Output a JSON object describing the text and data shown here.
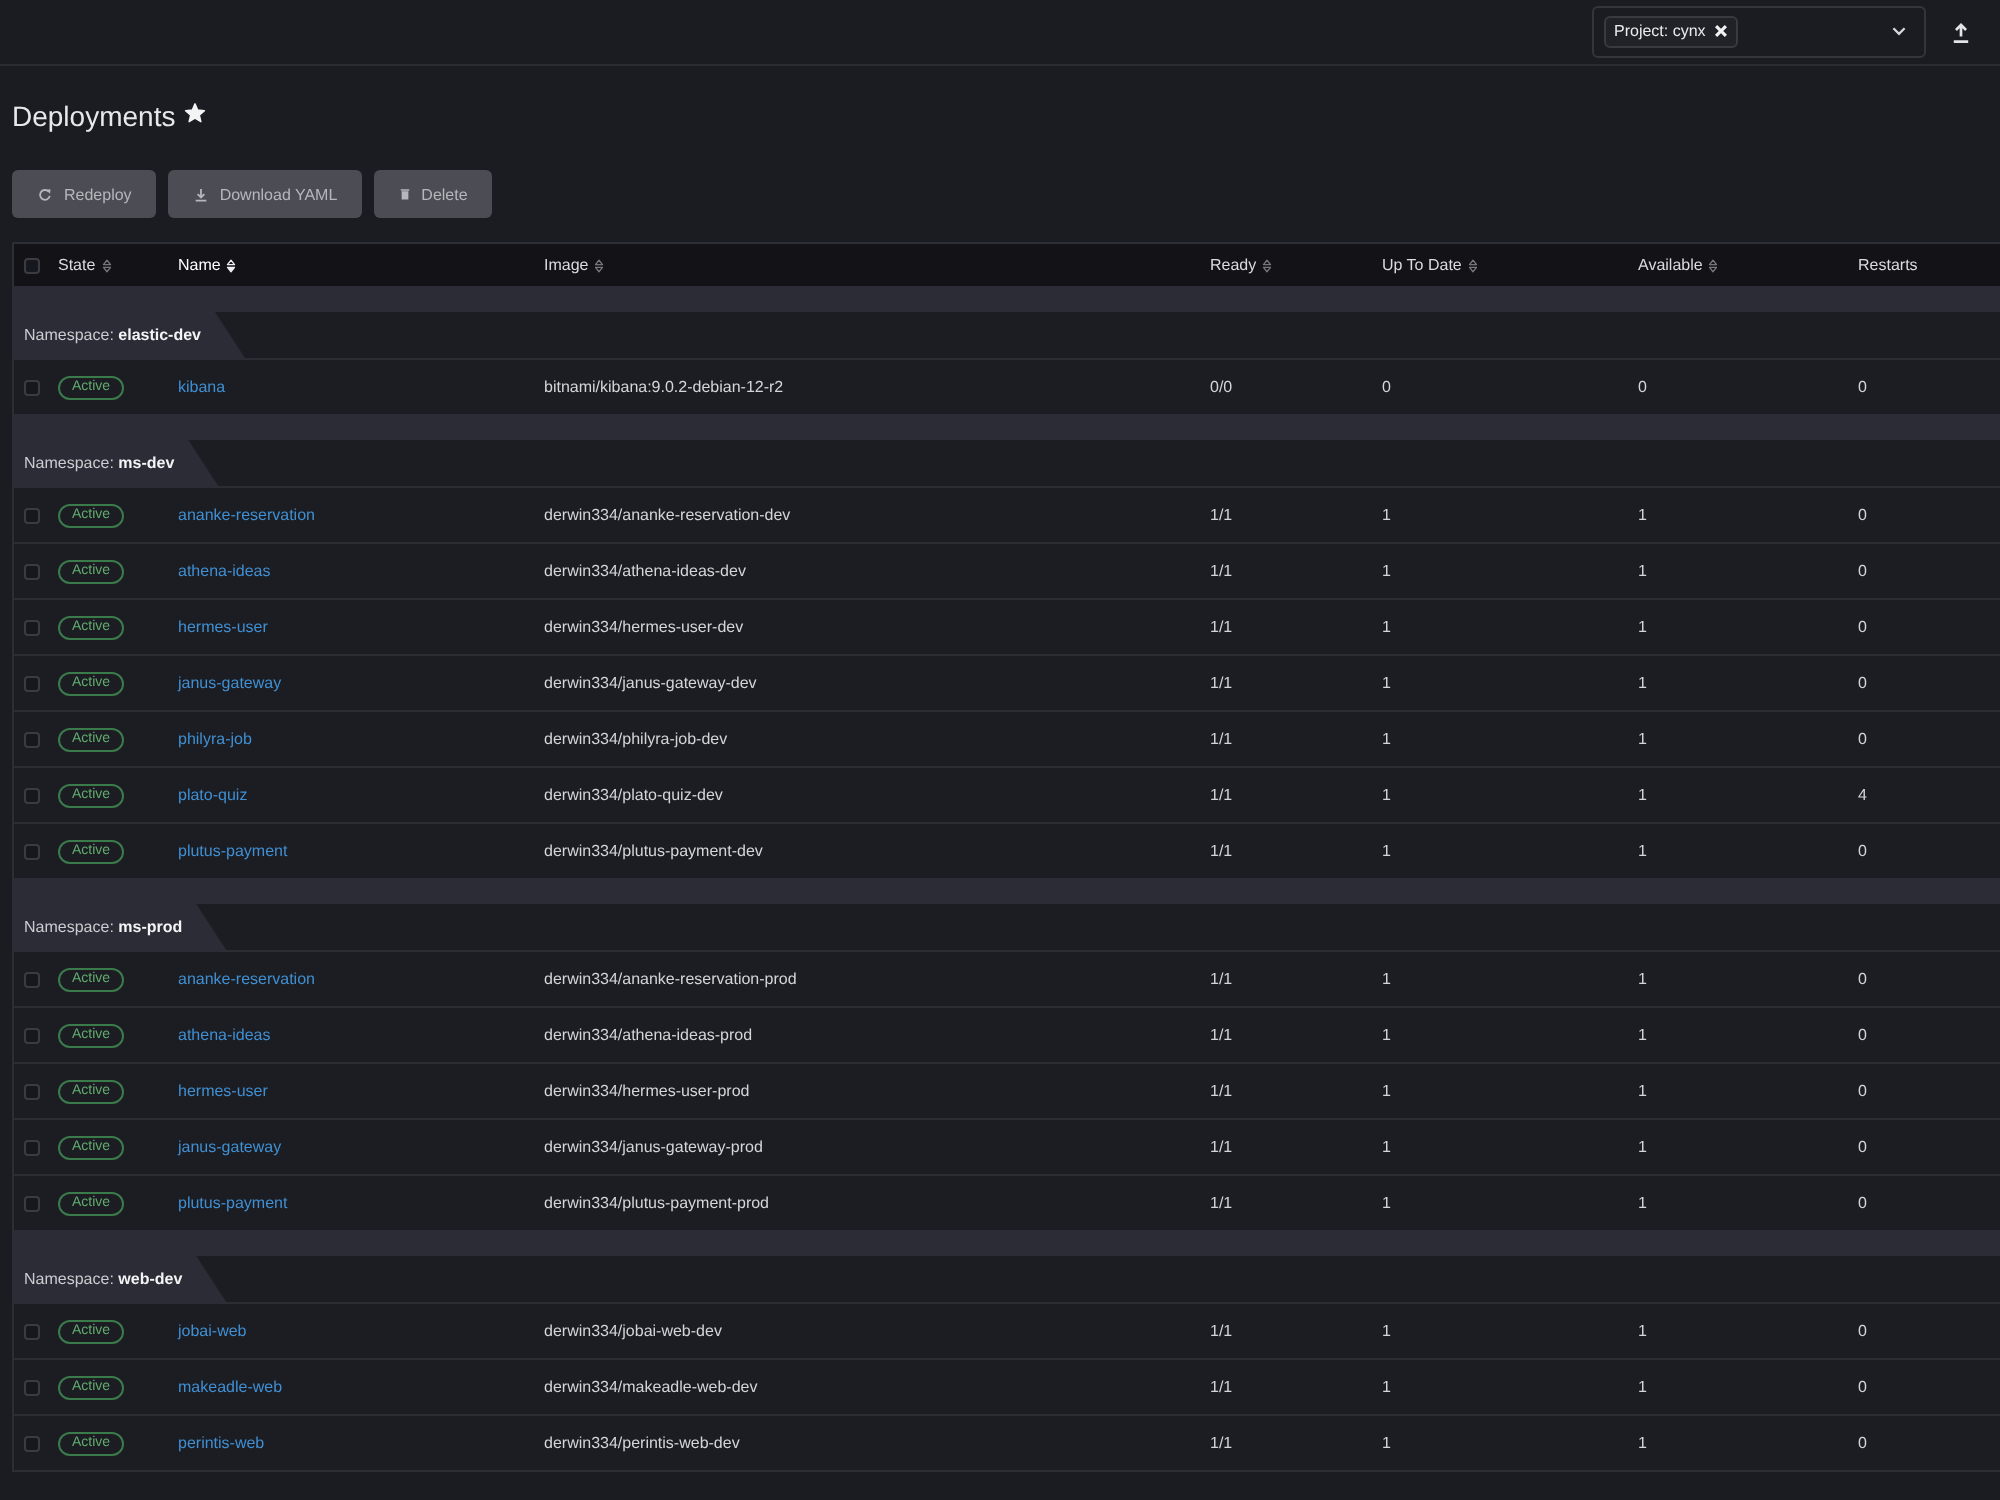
{
  "top_bar": {
    "project_filter": {
      "chips": [
        {
          "label": "Project: cynx"
        }
      ]
    }
  },
  "page": {
    "title": "Deployments",
    "favorite": true
  },
  "actions": [
    {
      "kind": "redeploy",
      "label": "Redeploy",
      "disabled": true
    },
    {
      "kind": "download",
      "label": "Download YAML",
      "disabled": true
    },
    {
      "kind": "delete",
      "label": "Delete",
      "disabled": true
    }
  ],
  "table": {
    "select_all": {
      "checked": false
    },
    "columns": [
      {
        "label": "State",
        "sortable": true,
        "sorted": false
      },
      {
        "label": "Name",
        "sortable": true,
        "sorted": true
      },
      {
        "label": "Image",
        "sortable": true,
        "sorted": false
      },
      {
        "label": "Ready",
        "sortable": true,
        "sorted": false
      },
      {
        "label": "Up To Date",
        "sortable": true,
        "sorted": false
      },
      {
        "label": "Available",
        "sortable": true,
        "sorted": false
      },
      {
        "label": "Restarts",
        "sortable": false,
        "sorted": false
      }
    ],
    "groups": [
      {
        "label": "Namespace: **elastic-dev**",
        "rows": [
          {
            "selected": false,
            "state": "Active",
            "name": "kibana",
            "image": "bitnami/kibana:9.0.2-debian-12-r2",
            "ready": "0/0",
            "up_to_date": "0",
            "available": "0",
            "restarts": "0"
          }
        ]
      },
      {
        "label": "Namespace: **ms-dev**",
        "rows": [
          {
            "selected": false,
            "state": "Active",
            "name": "ananke-reservation",
            "image": "derwin334/ananke-reservation-dev",
            "ready": "1/1",
            "up_to_date": "1",
            "available": "1",
            "restarts": "0"
          },
          {
            "selected": false,
            "state": "Active",
            "name": "athena-ideas",
            "image": "derwin334/athena-ideas-dev",
            "ready": "1/1",
            "up_to_date": "1",
            "available": "1",
            "restarts": "0"
          },
          {
            "selected": false,
            "state": "Active",
            "name": "hermes-user",
            "image": "derwin334/hermes-user-dev",
            "ready": "1/1",
            "up_to_date": "1",
            "available": "1",
            "restarts": "0"
          },
          {
            "selected": false,
            "state": "Active",
            "name": "janus-gateway",
            "image": "derwin334/janus-gateway-dev",
            "ready": "1/1",
            "up_to_date": "1",
            "available": "1",
            "restarts": "0"
          },
          {
            "selected": false,
            "state": "Active",
            "name": "philyra-job",
            "image": "derwin334/philyra-job-dev",
            "ready": "1/1",
            "up_to_date": "1",
            "available": "1",
            "restarts": "0"
          },
          {
            "selected": false,
            "state": "Active",
            "name": "plato-quiz",
            "image": "derwin334/plato-quiz-dev",
            "ready": "1/1",
            "up_to_date": "1",
            "available": "1",
            "restarts": "4"
          },
          {
            "selected": false,
            "state": "Active",
            "name": "plutus-payment",
            "image": "derwin334/plutus-payment-dev",
            "ready": "1/1",
            "up_to_date": "1",
            "available": "1",
            "restarts": "0"
          }
        ]
      },
      {
        "label": "Namespace: **ms-prod**",
        "rows": [
          {
            "selected": false,
            "state": "Active",
            "name": "ananke-reservation",
            "image": "derwin334/ananke-reservation-prod",
            "ready": "1/1",
            "up_to_date": "1",
            "available": "1",
            "restarts": "0"
          },
          {
            "selected": false,
            "state": "Active",
            "name": "athena-ideas",
            "image": "derwin334/athena-ideas-prod",
            "ready": "1/1",
            "up_to_date": "1",
            "available": "1",
            "restarts": "0"
          },
          {
            "selected": false,
            "state": "Active",
            "name": "hermes-user",
            "image": "derwin334/hermes-user-prod",
            "ready": "1/1",
            "up_to_date": "1",
            "available": "1",
            "restarts": "0"
          },
          {
            "selected": false,
            "state": "Active",
            "name": "janus-gateway",
            "image": "derwin334/janus-gateway-prod",
            "ready": "1/1",
            "up_to_date": "1",
            "available": "1",
            "restarts": "0"
          },
          {
            "selected": false,
            "state": "Active",
            "name": "plutus-payment",
            "image": "derwin334/plutus-payment-prod",
            "ready": "1/1",
            "up_to_date": "1",
            "available": "1",
            "restarts": "0"
          }
        ]
      },
      {
        "label": "Namespace: **web-dev**",
        "rows": [
          {
            "selected": false,
            "state": "Active",
            "name": "jobai-web",
            "image": "derwin334/jobai-web-dev",
            "ready": "1/1",
            "up_to_date": "1",
            "available": "1",
            "restarts": "0"
          },
          {
            "selected": false,
            "state": "Active",
            "name": "makeadle-web",
            "image": "derwin334/makeadle-web-dev",
            "ready": "1/1",
            "up_to_date": "1",
            "available": "1",
            "restarts": "0"
          },
          {
            "selected": false,
            "state": "Active",
            "name": "perintis-web",
            "image": "derwin334/perintis-web-dev",
            "ready": "1/1",
            "up_to_date": "1",
            "available": "1",
            "restarts": "0"
          }
        ]
      }
    ]
  }
}
